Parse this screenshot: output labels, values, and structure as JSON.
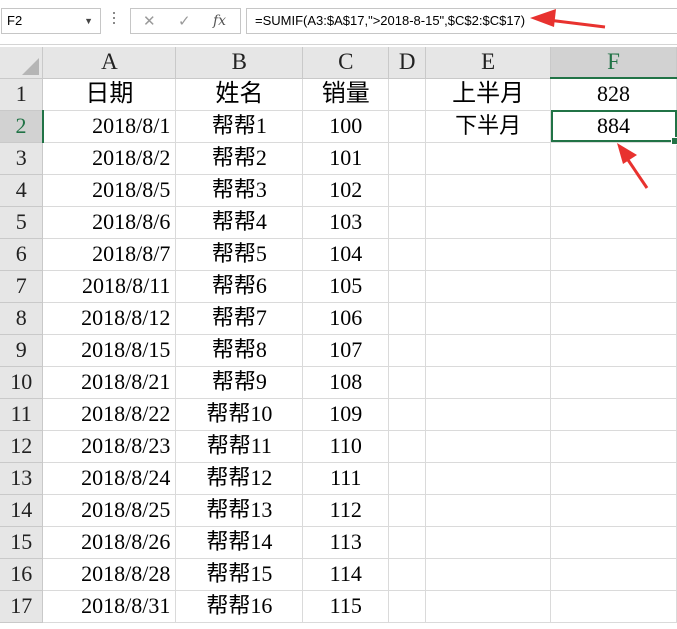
{
  "formula_bar": {
    "name_box": "F2",
    "cancel_glyph": "✕",
    "enter_glyph": "✓",
    "fx_label": "fx",
    "formula": "=SUMIF(A3:$A$17,\">2018-8-15\",$C$2:$C$17)"
  },
  "columns": [
    "A",
    "B",
    "C",
    "D",
    "E",
    "F"
  ],
  "rows": [
    {
      "num": "1",
      "A": "日期",
      "B": "姓名",
      "C": "销量",
      "D": "",
      "E": "上半月",
      "F": "828"
    },
    {
      "num": "2",
      "A": "2018/8/1",
      "B": "帮帮1",
      "C": "100",
      "D": "",
      "E": "下半月",
      "F": "884"
    },
    {
      "num": "3",
      "A": "2018/8/2",
      "B": "帮帮2",
      "C": "101",
      "D": "",
      "E": "",
      "F": ""
    },
    {
      "num": "4",
      "A": "2018/8/5",
      "B": "帮帮3",
      "C": "102",
      "D": "",
      "E": "",
      "F": ""
    },
    {
      "num": "5",
      "A": "2018/8/6",
      "B": "帮帮4",
      "C": "103",
      "D": "",
      "E": "",
      "F": ""
    },
    {
      "num": "6",
      "A": "2018/8/7",
      "B": "帮帮5",
      "C": "104",
      "D": "",
      "E": "",
      "F": ""
    },
    {
      "num": "7",
      "A": "2018/8/11",
      "B": "帮帮6",
      "C": "105",
      "D": "",
      "E": "",
      "F": ""
    },
    {
      "num": "8",
      "A": "2018/8/12",
      "B": "帮帮7",
      "C": "106",
      "D": "",
      "E": "",
      "F": ""
    },
    {
      "num": "9",
      "A": "2018/8/15",
      "B": "帮帮8",
      "C": "107",
      "D": "",
      "E": "",
      "F": ""
    },
    {
      "num": "10",
      "A": "2018/8/21",
      "B": "帮帮9",
      "C": "108",
      "D": "",
      "E": "",
      "F": ""
    },
    {
      "num": "11",
      "A": "2018/8/22",
      "B": "帮帮10",
      "C": "109",
      "D": "",
      "E": "",
      "F": ""
    },
    {
      "num": "12",
      "A": "2018/8/23",
      "B": "帮帮11",
      "C": "110",
      "D": "",
      "E": "",
      "F": ""
    },
    {
      "num": "13",
      "A": "2018/8/24",
      "B": "帮帮12",
      "C": "111",
      "D": "",
      "E": "",
      "F": ""
    },
    {
      "num": "14",
      "A": "2018/8/25",
      "B": "帮帮13",
      "C": "112",
      "D": "",
      "E": "",
      "F": ""
    },
    {
      "num": "15",
      "A": "2018/8/26",
      "B": "帮帮14",
      "C": "113",
      "D": "",
      "E": "",
      "F": ""
    },
    {
      "num": "16",
      "A": "2018/8/28",
      "B": "帮帮15",
      "C": "114",
      "D": "",
      "E": "",
      "F": ""
    },
    {
      "num": "17",
      "A": "2018/8/31",
      "B": "帮帮16",
      "C": "115",
      "D": "",
      "E": "",
      "F": ""
    }
  ],
  "selection": {
    "column": "F",
    "row": "2"
  },
  "colors": {
    "accent": "#217346",
    "annotation_arrow": "#e8322f"
  }
}
